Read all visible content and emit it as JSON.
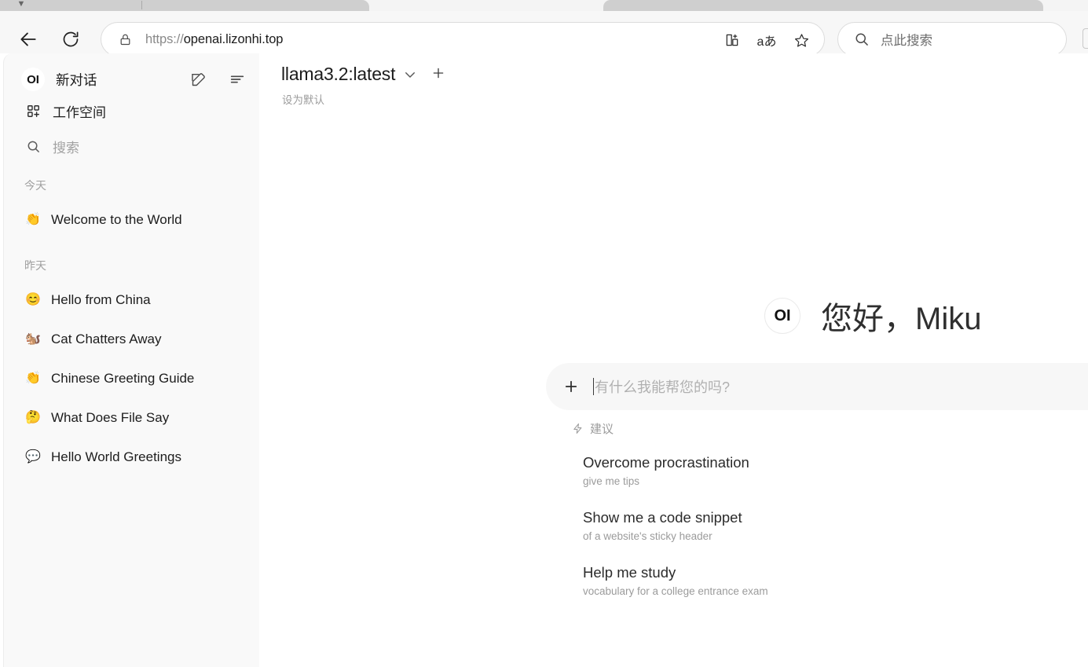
{
  "browser": {
    "url_scheme": "https://",
    "url_host": "openai.lizonhi.top",
    "back_icon": "back-arrow-icon",
    "reload_icon": "reload-icon",
    "lock_icon": "lock-icon",
    "split_screen_icon": "split-screen-icon",
    "read_aloud_label": "aあ",
    "favorite_icon": "star-icon",
    "search_placeholder": "点此搜索",
    "search_icon": "search-icon"
  },
  "sidebar": {
    "logo_text": "OI",
    "new_chat_label": "新对话",
    "compose_icon": "compose-icon",
    "toggle_icon": "sidebar-toggle-icon",
    "nav": [
      {
        "label": "工作空间",
        "icon": "workspace-grid-plus-icon"
      },
      {
        "label": "搜索",
        "icon": "search-icon"
      }
    ],
    "groups": [
      {
        "title": "今天",
        "items": [
          {
            "emoji": "👏",
            "title": "Welcome to the World"
          }
        ]
      },
      {
        "title": "昨天",
        "items": [
          {
            "emoji": "😊",
            "title": "Hello from China"
          },
          {
            "emoji": "🐿️",
            "title": "Cat Chatters Away"
          },
          {
            "emoji": "👏",
            "title": "Chinese Greeting Guide"
          },
          {
            "emoji": "🤔",
            "title": "What Does File Say"
          },
          {
            "emoji": "💬",
            "title": "Hello World Greetings"
          }
        ]
      }
    ]
  },
  "main": {
    "model_name": "llama3.2:latest",
    "model_chevron_icon": "chevron-down-icon",
    "model_add_icon": "plus-icon",
    "set_default_label": "设为默认",
    "greeting_avatar_text": "OI",
    "greeting_text": "您好，Miku",
    "composer": {
      "add_icon": "plus-icon",
      "placeholder": "有什么我能帮您的吗?"
    },
    "suggestions_header": "建议",
    "suggestions_icon": "lightning-bolt-icon",
    "suggestions": [
      {
        "title": "Overcome procrastination",
        "subtitle": "give me tips"
      },
      {
        "title": "Show me a code snippet",
        "subtitle": "of a website's sticky header"
      },
      {
        "title": "Help me study",
        "subtitle": "vocabulary for a college entrance exam"
      }
    ]
  },
  "colors": {
    "sidebar_bg": "#f9f9f9",
    "page_bg": "#ffffff",
    "composer_bg": "#f7f7f7",
    "muted_text": "#9b9b9b"
  }
}
